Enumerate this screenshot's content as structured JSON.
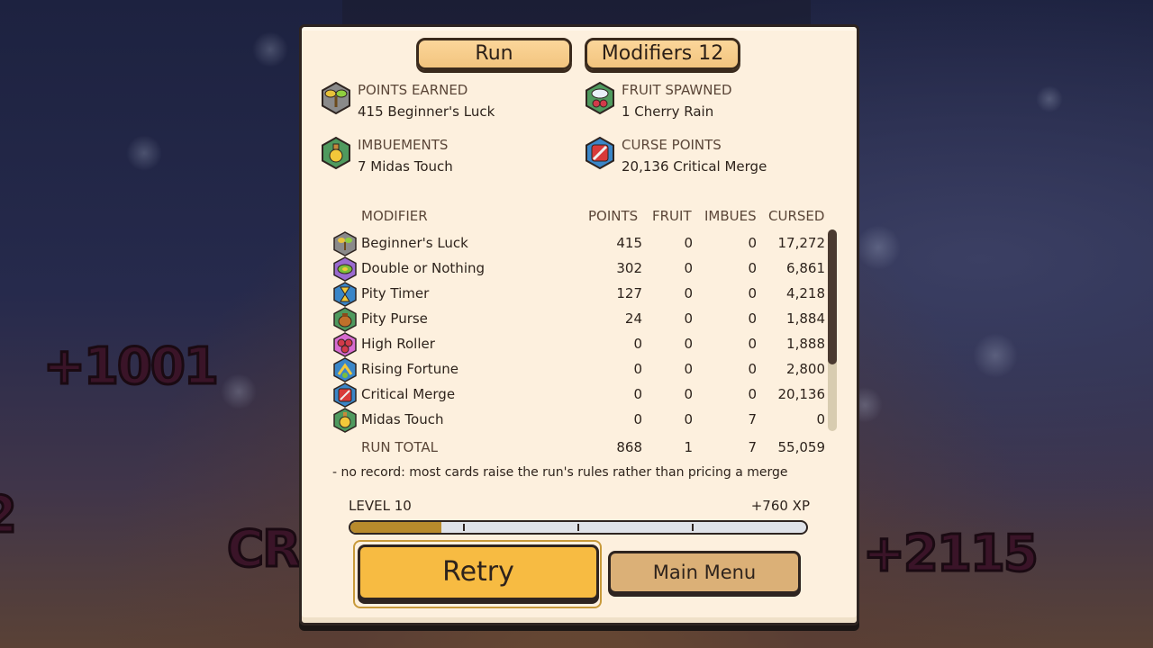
{
  "tabs": {
    "run": "Run",
    "modifiers": "Modifiers  12"
  },
  "summary": [
    {
      "icon": "sprout-icon",
      "label": "POINTS EARNED",
      "value": "415  Beginner's Luck"
    },
    {
      "icon": "cherry-cloud-icon",
      "label": "FRUIT SPAWNED",
      "value": "1  Cherry Rain"
    },
    {
      "icon": "potion-icon",
      "label": "IMBUEMENTS",
      "value": "7  Midas Touch"
    },
    {
      "icon": "sword-icon",
      "label": "CURSE POINTS",
      "value": "20,136  Critical Merge"
    }
  ],
  "table": {
    "headers": {
      "modifier": "MODIFIER",
      "points": "POINTS",
      "fruit": "FRUIT",
      "imbues": "IMBUES",
      "cursed": "CURSED"
    },
    "rows": [
      {
        "icon": "sprout-icon",
        "name": "Beginner's Luck",
        "points": "415",
        "fruit": "0",
        "imbues": "0",
        "cursed": "17,272"
      },
      {
        "icon": "coin-icon",
        "name": "Double or Nothing",
        "points": "302",
        "fruit": "0",
        "imbues": "0",
        "cursed": "6,861"
      },
      {
        "icon": "hourglass-icon",
        "name": "Pity Timer",
        "points": "127",
        "fruit": "0",
        "imbues": "0",
        "cursed": "4,218"
      },
      {
        "icon": "purse-icon",
        "name": "Pity Purse",
        "points": "24",
        "fruit": "0",
        "imbues": "0",
        "cursed": "1,884"
      },
      {
        "icon": "dice-icon",
        "name": "High Roller",
        "points": "0",
        "fruit": "0",
        "imbues": "0",
        "cursed": "1,888"
      },
      {
        "icon": "rising-arrow-icon",
        "name": "Rising Fortune",
        "points": "0",
        "fruit": "0",
        "imbues": "0",
        "cursed": "2,800"
      },
      {
        "icon": "sword-icon",
        "name": "Critical Merge",
        "points": "0",
        "fruit": "0",
        "imbues": "0",
        "cursed": "20,136"
      },
      {
        "icon": "potion-icon",
        "name": "Midas Touch",
        "points": "0",
        "fruit": "0",
        "imbues": "7",
        "cursed": "0"
      }
    ],
    "total": {
      "name": "RUN TOTAL",
      "points": "868",
      "fruit": "1",
      "imbues": "7",
      "cursed": "55,059"
    }
  },
  "note": "-  no record: most cards raise the run's rules rather than pricing a merge",
  "level": {
    "label": "LEVEL 10",
    "xp": "+760 XP",
    "progress": 0.2
  },
  "buttons": {
    "retry": "Retry",
    "main_menu": "Main Menu"
  },
  "background": {
    "float1": "+1001",
    "float2": "CR",
    "float3": "+2115",
    "float4": "2"
  },
  "colors": {
    "panel": "#fdf0de",
    "retry": "#f7bb42",
    "main_menu": "#dbb077",
    "tab": "#f2c47e",
    "xp_fill": "#b88a2c"
  }
}
